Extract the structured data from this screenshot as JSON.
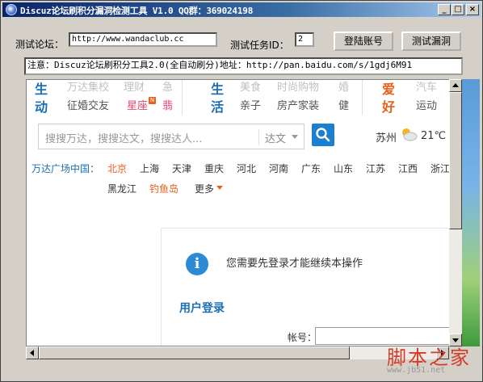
{
  "window": {
    "title": "Discuz论坛刷积分漏洞检测工具 V1.0  QQ群：369024198",
    "min": "_",
    "max": "□",
    "close": "×"
  },
  "form": {
    "forum_label": "测试论坛：",
    "forum_url": "http://www.wandaclub.cc",
    "task_label": "测试任务ID：",
    "task_id": "2",
    "login_button": "登陆账号",
    "test_button": "测试漏洞",
    "notice": "注意：Discuz论坛刷积分工具2.0(全自动刷分)地址：http://pan.baidu.com/s/1gdj6M91"
  },
  "web": {
    "nav1": {
      "big_top": "生",
      "big_bottom": "动",
      "top_items": [
        "万达集校",
        "理财",
        "急"
      ],
      "bottom_items": [
        "征婚交友",
        "星座",
        "翡"
      ],
      "star_badge": "N"
    },
    "nav2": {
      "big_top": "生",
      "big_bottom": "活",
      "top_items": [
        "美食",
        "时尚购物",
        "婚"
      ],
      "bottom_items": [
        "亲子",
        "房产家装",
        "健"
      ]
    },
    "nav3": {
      "big_top": "爱",
      "big_bottom": "好",
      "top_items": [
        "汽车"
      ],
      "bottom_items": [
        "运动"
      ]
    },
    "search": {
      "placeholder": "搜搜万达，搜搜达文，搜搜达人...",
      "category": "达文"
    },
    "weather": {
      "city": "苏州",
      "temp": "21℃ ~"
    },
    "cities_label": "万达广场中国：",
    "cities": [
      "北京",
      "上海",
      "天津",
      "重庆",
      "河北",
      "河南",
      "广东",
      "山东",
      "江苏",
      "江西",
      "浙江"
    ],
    "cities2": [
      "黑龙江",
      "钓鱼岛",
      "更多"
    ],
    "colors": {
      "active": "#e8611b",
      "blue": "#1c6fb4",
      "pink": "#e8456b"
    },
    "panel": {
      "message": "您需要先登录才能继续本操作",
      "heading": "用户登录",
      "account_label": "帐号："
    }
  },
  "watermark": {
    "text": "脚本之家",
    "sub": "www.jb51.net"
  }
}
